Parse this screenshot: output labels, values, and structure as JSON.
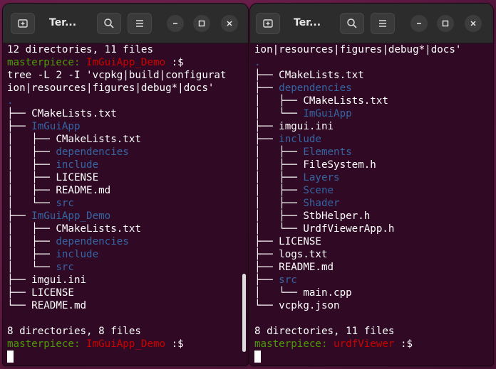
{
  "windows": [
    {
      "title": "Ter...",
      "lines": [
        [
          {
            "t": "12 directories, 11 files",
            "c": ""
          }
        ],
        [
          {
            "t": "masterpiece: ",
            "c": "prompt-user"
          },
          {
            "t": "ImGuiApp_Demo",
            "c": "prompt-dir"
          },
          {
            "t": " :$",
            "c": ""
          }
        ],
        [
          {
            "t": "tree -L 2 -I 'vcpkg|build|configurat",
            "c": ""
          }
        ],
        [
          {
            "t": "ion|resources|figures|debug*|docs'",
            "c": ""
          }
        ],
        [
          {
            "t": ".",
            "c": "dirname"
          }
        ],
        [
          {
            "t": "├── ",
            "c": ""
          },
          {
            "t": "CMakeLists.txt",
            "c": ""
          }
        ],
        [
          {
            "t": "├── ",
            "c": ""
          },
          {
            "t": "ImGuiApp",
            "c": "dirname"
          }
        ],
        [
          {
            "t": "│   ├── ",
            "c": ""
          },
          {
            "t": "CMakeLists.txt",
            "c": ""
          }
        ],
        [
          {
            "t": "│   ├── ",
            "c": ""
          },
          {
            "t": "dependencies",
            "c": "dirname"
          }
        ],
        [
          {
            "t": "│   ├── ",
            "c": ""
          },
          {
            "t": "include",
            "c": "dirname"
          }
        ],
        [
          {
            "t": "│   ├── ",
            "c": ""
          },
          {
            "t": "LICENSE",
            "c": ""
          }
        ],
        [
          {
            "t": "│   ├── ",
            "c": ""
          },
          {
            "t": "README.md",
            "c": ""
          }
        ],
        [
          {
            "t": "│   └── ",
            "c": ""
          },
          {
            "t": "src",
            "c": "dirname"
          }
        ],
        [
          {
            "t": "├── ",
            "c": ""
          },
          {
            "t": "ImGuiApp_Demo",
            "c": "dirname"
          }
        ],
        [
          {
            "t": "│   ├── ",
            "c": ""
          },
          {
            "t": "CMakeLists.txt",
            "c": ""
          }
        ],
        [
          {
            "t": "│   ├── ",
            "c": ""
          },
          {
            "t": "dependencies",
            "c": "dirname"
          }
        ],
        [
          {
            "t": "│   ├── ",
            "c": ""
          },
          {
            "t": "include",
            "c": "dirname"
          }
        ],
        [
          {
            "t": "│   └── ",
            "c": ""
          },
          {
            "t": "src",
            "c": "dirname"
          }
        ],
        [
          {
            "t": "├── ",
            "c": ""
          },
          {
            "t": "imgui.ini",
            "c": ""
          }
        ],
        [
          {
            "t": "├── ",
            "c": ""
          },
          {
            "t": "LICENSE",
            "c": ""
          }
        ],
        [
          {
            "t": "└── ",
            "c": ""
          },
          {
            "t": "README.md",
            "c": ""
          }
        ],
        [
          {
            "t": "",
            "c": ""
          }
        ],
        [
          {
            "t": "8 directories, 8 files",
            "c": ""
          }
        ],
        [
          {
            "t": "masterpiece: ",
            "c": "prompt-user"
          },
          {
            "t": "ImGuiApp_Demo",
            "c": "prompt-dir"
          },
          {
            "t": " :$",
            "c": ""
          }
        ],
        [
          {
            "t": "",
            "c": "cursor"
          }
        ]
      ]
    },
    {
      "title": "Ter...",
      "lines": [
        [
          {
            "t": "ion|resources|figures|debug*|docs'",
            "c": ""
          }
        ],
        [
          {
            "t": ".",
            "c": "dirname"
          }
        ],
        [
          {
            "t": "├── ",
            "c": ""
          },
          {
            "t": "CMakeLists.txt",
            "c": ""
          }
        ],
        [
          {
            "t": "├── ",
            "c": ""
          },
          {
            "t": "dependencies",
            "c": "dirname"
          }
        ],
        [
          {
            "t": "│   ├── ",
            "c": ""
          },
          {
            "t": "CMakeLists.txt",
            "c": ""
          }
        ],
        [
          {
            "t": "│   └── ",
            "c": ""
          },
          {
            "t": "ImGuiApp",
            "c": "dirname"
          }
        ],
        [
          {
            "t": "├── ",
            "c": ""
          },
          {
            "t": "imgui.ini",
            "c": ""
          }
        ],
        [
          {
            "t": "├── ",
            "c": ""
          },
          {
            "t": "include",
            "c": "dirname"
          }
        ],
        [
          {
            "t": "│   ├── ",
            "c": ""
          },
          {
            "t": "Elements",
            "c": "dirname"
          }
        ],
        [
          {
            "t": "│   ├── ",
            "c": ""
          },
          {
            "t": "FileSystem.h",
            "c": ""
          }
        ],
        [
          {
            "t": "│   ├── ",
            "c": ""
          },
          {
            "t": "Layers",
            "c": "dirname"
          }
        ],
        [
          {
            "t": "│   ├── ",
            "c": ""
          },
          {
            "t": "Scene",
            "c": "dirname"
          }
        ],
        [
          {
            "t": "│   ├── ",
            "c": ""
          },
          {
            "t": "Shader",
            "c": "dirname"
          }
        ],
        [
          {
            "t": "│   ├── ",
            "c": ""
          },
          {
            "t": "StbHelper.h",
            "c": ""
          }
        ],
        [
          {
            "t": "│   └── ",
            "c": ""
          },
          {
            "t": "UrdfViewerApp.h",
            "c": ""
          }
        ],
        [
          {
            "t": "├── ",
            "c": ""
          },
          {
            "t": "LICENSE",
            "c": ""
          }
        ],
        [
          {
            "t": "├── ",
            "c": ""
          },
          {
            "t": "logs.txt",
            "c": ""
          }
        ],
        [
          {
            "t": "├── ",
            "c": ""
          },
          {
            "t": "README.md",
            "c": ""
          }
        ],
        [
          {
            "t": "├── ",
            "c": ""
          },
          {
            "t": "src",
            "c": "dirname"
          }
        ],
        [
          {
            "t": "│   └── ",
            "c": ""
          },
          {
            "t": "main.cpp",
            "c": ""
          }
        ],
        [
          {
            "t": "└── ",
            "c": ""
          },
          {
            "t": "vcpkg.json",
            "c": ""
          }
        ],
        [
          {
            "t": "",
            "c": ""
          }
        ],
        [
          {
            "t": "8 directories, 11 files",
            "c": ""
          }
        ],
        [
          {
            "t": "masterpiece: ",
            "c": "prompt-user"
          },
          {
            "t": "urdfViewer",
            "c": "prompt-dir"
          },
          {
            "t": " :$",
            "c": ""
          }
        ],
        [
          {
            "t": "",
            "c": "cursor"
          }
        ]
      ]
    }
  ],
  "icons": {
    "new_tab": "new-tab-icon",
    "search": "search-icon",
    "menu": "hamburger-menu-icon",
    "minimize": "minimize-icon",
    "maximize": "maximize-icon",
    "close": "close-icon"
  },
  "colors": {
    "terminal_bg": "#300a24",
    "prompt_user": "#4e9a06",
    "prompt_dir": "#cc0000",
    "directory": "#3465a4"
  }
}
